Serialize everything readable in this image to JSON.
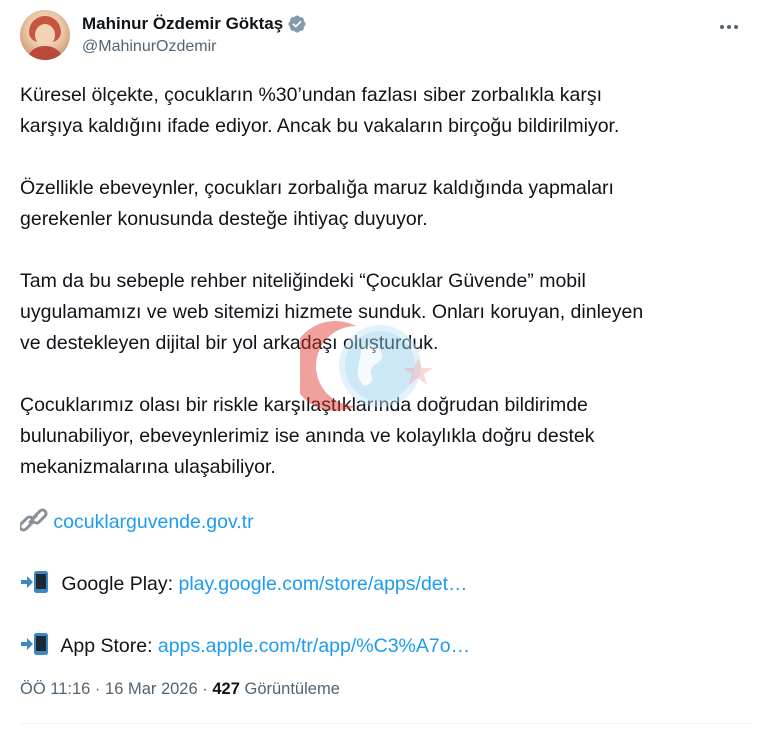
{
  "author": {
    "name": "Mahinur Özdemir Göktaş",
    "handle": "@MahinurOzdemir"
  },
  "tweet": {
    "paragraphs": [
      [
        "Küresel ölçekte, çocukların %30’undan fazlası siber zorbalıkla karşı",
        "karşıya kaldığını ifade ediyor. Ancak bu vakaların birçoğu bildirilmiyor."
      ],
      [
        "Özellikle ebeveynler, çocukları zorbalığa maruz kaldığında yapmaları",
        "gerekenler konusunda desteğe ihtiyaç duyuyor."
      ],
      [
        "Tam da bu sebeple rehber niteliğindeki “Çocuklar Güvende” mobil",
        "uygulamamızı ve web sitemizi hizmete sunduk. Onları koruyan, dinleyen",
        "ve destekleyen dijital bir yol arkadaşı oluşturduk."
      ],
      [
        "Çocuklarımız olası bir riskle karşılaştıklarında doğrudan bildirimde",
        "bulunabiliyor, ebeveynlerimiz ise anında ve kolaylıkla doğru destek",
        "mekanizmalarına ulaşabiliyor."
      ]
    ],
    "website_link": "cocuklarguvende.gov.tr",
    "google_play_label": "Google Play:",
    "google_play_link": "play.google.com/store/apps/det…",
    "app_store_label": "App Store:",
    "app_store_link": "apps.apple.com/tr/app/%C3%A7o…"
  },
  "meta": {
    "time": "ÖÖ 11:16",
    "date": "16 Mar 2026",
    "views_count": "427",
    "views_label": "Görüntüleme"
  },
  "colors": {
    "link": "#1d9bf0",
    "secondary_text": "#536471",
    "verified_badge": "#829aab"
  },
  "icons": {
    "verified": "verified-badge-icon",
    "more": "more-options-icon",
    "link": "link-icon",
    "phone": "mobile-phone-arrow-icon"
  }
}
